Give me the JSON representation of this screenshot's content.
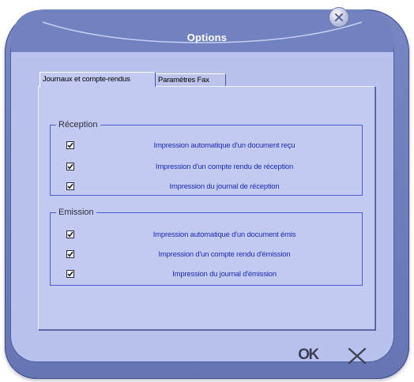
{
  "window": {
    "title": "Options"
  },
  "tabs": [
    {
      "label": "Journaux et compte-rendus",
      "active": true
    },
    {
      "label": "Paramètres Fax",
      "active": false
    }
  ],
  "reception": {
    "title": "Réception",
    "options": [
      {
        "label": "Impression automatique d'un document reçu",
        "checked": true
      },
      {
        "label": "Impression  d'un compte rendu de réception",
        "checked": true
      },
      {
        "label": "Impression du journal de réception",
        "checked": true
      }
    ]
  },
  "emission": {
    "title": "Emission",
    "options": [
      {
        "label": "Impression automatique d'un document émis",
        "checked": true
      },
      {
        "label": "Impression  d'un compte rendu d'émission",
        "checked": true
      },
      {
        "label": "Impression du journal d'émission",
        "checked": true
      }
    ]
  },
  "buttons": {
    "ok_label": "OK",
    "cancel_icon": "close-x-icon"
  },
  "colors": {
    "frame": "#6676b5",
    "panel": "#c2caf1",
    "label_text": "#1c2bb0",
    "group_border": "#4d5fd0"
  }
}
